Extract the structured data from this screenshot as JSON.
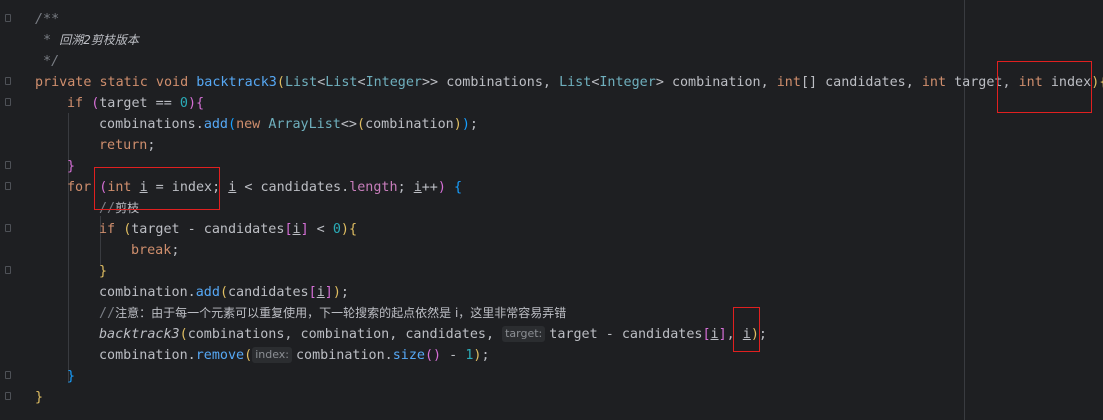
{
  "code": {
    "l1": "/**",
    "l2_star": " * ",
    "l2_text": "回溯2剪枝版本",
    "l3": " */",
    "l4": {
      "kw": "private static void ",
      "name": "backtrack3",
      "p_open": "(",
      "t_list": "List",
      "lt1": "<",
      "t_list2": "List",
      "lt2": "<",
      "t_int": "Integer",
      "gt": ">> ",
      "a1": "combinations, ",
      "t_list3": "List",
      "lt3": "<",
      "t_int2": "Integer",
      "gt2": "> ",
      "a2": "combination, ",
      "kw_int1": "int",
      "arr": "[] ",
      "a3": "candidates, ",
      "kw_int2": "int",
      "a4": " target, ",
      "kw_int3": "int",
      "a5": " index",
      "p_close": ")",
      "brace": "{"
    },
    "l5": {
      "kw": "if ",
      "open": "(",
      "rest": "target == ",
      "num": "0",
      "close": ")",
      "brace": "{"
    },
    "l6": {
      "obj": "combinations.",
      "m": "add",
      "open": "(",
      "kw": "new ",
      "cls": "ArrayList",
      "diamond": "<>",
      "o2": "(",
      "arg": "combination",
      "c2": ")",
      "c1": ")",
      "semi": ";"
    },
    "l7": {
      "kw": "return",
      "semi": ";"
    },
    "l8": "}",
    "l9": {
      "kw": "for ",
      "open": "(",
      "kw_int": "int ",
      "i1": "i",
      "eq": " = index; ",
      "i2": "i",
      "cond": " < candidates.",
      "fld": "length",
      "semi": "; ",
      "i3": "i",
      "inc": "++",
      "close": ")",
      "brace": " {"
    },
    "l10": {
      "slash": "//",
      "text": "剪枝"
    },
    "l11": {
      "kw": "if ",
      "open": "(",
      "a": "target - candidates",
      "b1": "[",
      "i": "i",
      "b2": "]",
      "c": " < ",
      "num": "0",
      "close": ")",
      "brace": "{"
    },
    "l12": {
      "kw": "break",
      "semi": ";"
    },
    "l13": "}",
    "l14": {
      "obj": "combination.",
      "m": "add",
      "open": "(",
      "arg": "candidates",
      "b1": "[",
      "i": "i",
      "b2": "]",
      "close": ")",
      "semi": ";"
    },
    "l15": {
      "slash": "//",
      "text": "注意：由于每一个元素可以重复使用，下一轮搜索的起点依然是 i，这里非常容易弄错"
    },
    "l16": {
      "name": "backtrack3",
      "open": "(",
      "args": "combinations, combination, candidates, ",
      "hint": "target:",
      "expr": "target - candidates",
      "b1": "[",
      "i": "i",
      "b2": "]",
      "comma": ", ",
      "i2": "i",
      "close": ")",
      "semi": ";"
    },
    "l17": {
      "obj": "combination.",
      "m": "remove",
      "open": "(",
      "hint": "index:",
      "a": "combination.",
      "m2": "size",
      "o2": "()",
      "rest": " - ",
      "num": "1",
      "close": ")",
      "semi": ";"
    },
    "l18": "}",
    "l19": "}"
  },
  "colors": {
    "background": "#1e1f22",
    "keyword": "#cf8e6d",
    "function": "#56a8f5",
    "comment": "#7a7e85",
    "number": "#2aacb8",
    "highlight_box": "#e02020"
  }
}
